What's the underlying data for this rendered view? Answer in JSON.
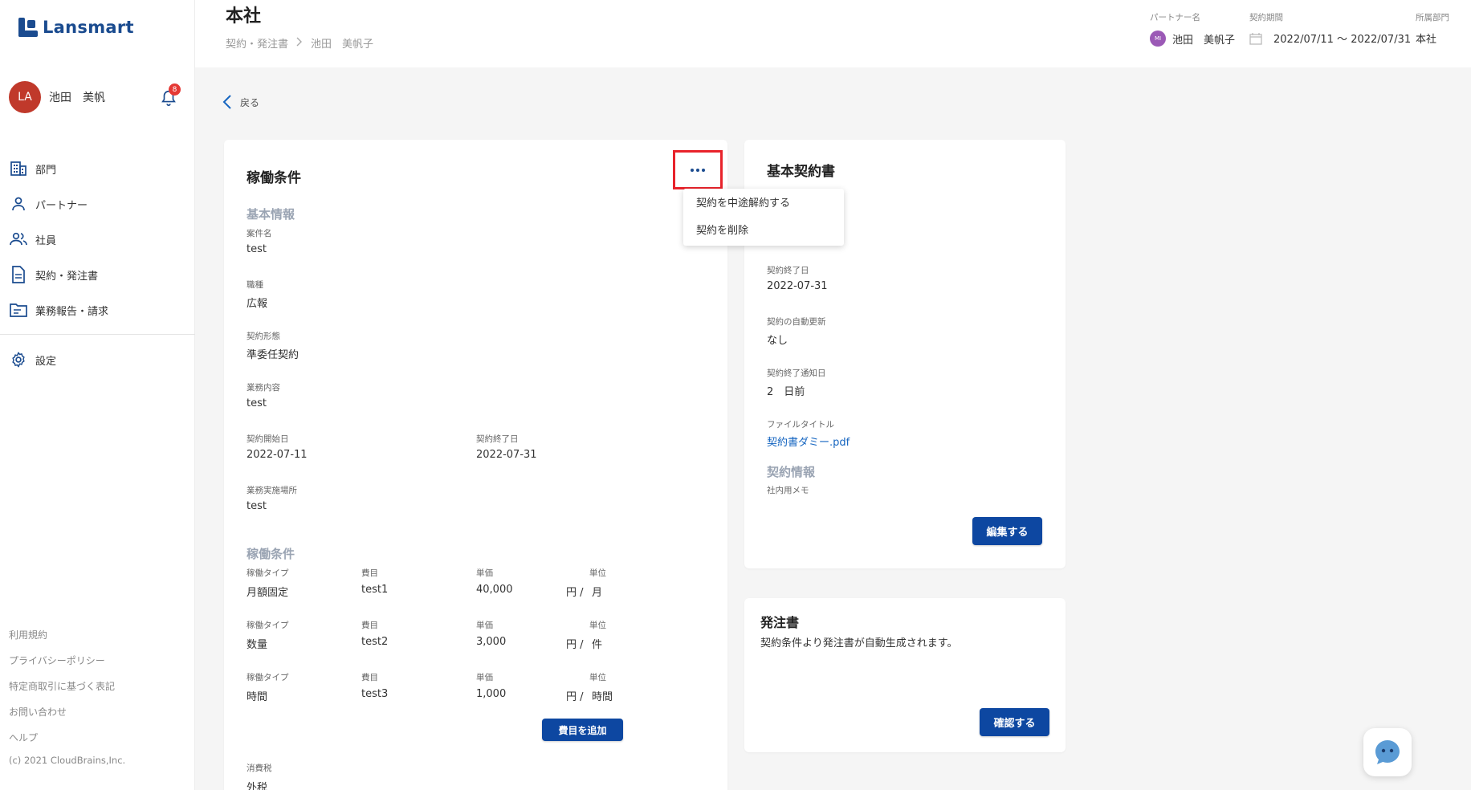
{
  "app": {
    "logo_text": "Lansmart"
  },
  "user": {
    "initials": "LA",
    "name": "池田　美帆",
    "notification_count": "8"
  },
  "nav": {
    "items": [
      {
        "label": "部門",
        "icon": "building-icon"
      },
      {
        "label": "パートナー",
        "icon": "person-icon"
      },
      {
        "label": "社員",
        "icon": "people-icon"
      },
      {
        "label": "契約・発注書",
        "icon": "document-icon"
      },
      {
        "label": "業務報告・請求",
        "icon": "folder-icon"
      }
    ],
    "settings_label": "設定"
  },
  "footer": {
    "links": [
      "利用規約",
      "プライバシーポリシー",
      "特定商取引に基づく表記",
      "お問い合わせ",
      "ヘルプ"
    ],
    "copyright": "(c) 2021 CloudBrains,Inc."
  },
  "header": {
    "title": "本社",
    "breadcrumb": [
      "契約・発注書",
      "池田　美帆子"
    ],
    "partner_label": "パートナー名",
    "partner_initials": "MI",
    "partner_name": "池田　美帆子",
    "period_label": "契約期間",
    "period_value": "2022/07/11 〜 2022/07/31",
    "dept_label": "所属部門",
    "dept_value": "本社"
  },
  "back_label": "戻る",
  "main_card": {
    "title": "稼働条件",
    "menu_items": [
      "契約を中途解約する",
      "契約を削除"
    ],
    "basic_section": "基本情報",
    "fields": {
      "project_name_label": "案件名",
      "project_name": "test",
      "job_type_label": "職種",
      "job_type": "広報",
      "contract_form_label": "契約形態",
      "contract_form": "準委任契約",
      "work_content_label": "業務内容",
      "work_content": "test",
      "start_label": "契約開始日",
      "start": "2022-07-11",
      "end_label": "契約終了日",
      "end": "2022-07-31",
      "place_label": "業務実施場所",
      "place": "test"
    },
    "conditions_section": "稼働条件",
    "cond_headers": {
      "type": "稼働タイプ",
      "item": "費目",
      "price": "単価",
      "unit": "単位"
    },
    "conditions": [
      {
        "type": "月額固定",
        "item": "test1",
        "price": "40,000",
        "yen": "円 /",
        "unit": "月"
      },
      {
        "type": "数量",
        "item": "test2",
        "price": "3,000",
        "yen": "円 /",
        "unit": "件"
      },
      {
        "type": "時間",
        "item": "test3",
        "price": "1,000",
        "yen": "円 /",
        "unit": "時間"
      }
    ],
    "add_item_button": "費目を追加",
    "tax_label": "消費税",
    "tax_value": "外税"
  },
  "contract_card": {
    "title": "基本契約書",
    "end_label": "契約終了日",
    "end": "2022-07-31",
    "auto_renew_label": "契約の自動更新",
    "auto_renew": "なし",
    "notice_label": "契約終了通知日",
    "notice": "2　日前",
    "file_title_label": "ファイルタイトル",
    "file_title": "契約書ダミー.pdf",
    "info_section": "契約情報",
    "memo_label": "社内用メモ",
    "edit_button": "編集する"
  },
  "po_card": {
    "title": "発注書",
    "description": "契約条件より発注書が自動生成されます。",
    "confirm_button": "確認する"
  },
  "colors": {
    "brand": "#1a4b8f",
    "button": "#0d47a1",
    "highlight": "#e8232b",
    "section_title": "#9aa4b3",
    "link": "#1565c0"
  }
}
